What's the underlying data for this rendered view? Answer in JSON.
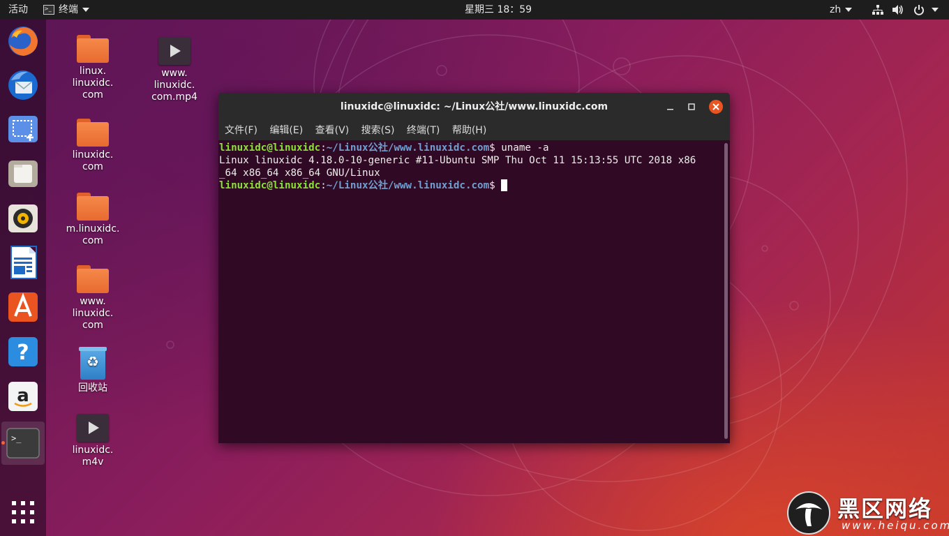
{
  "topbar": {
    "activities": "活动",
    "app_name": "终端",
    "clock": "星期三 18：59",
    "lang": "zh"
  },
  "dock": {
    "items": [
      {
        "name": "firefox"
      },
      {
        "name": "thunderbird"
      },
      {
        "name": "screenshot"
      },
      {
        "name": "files"
      },
      {
        "name": "rhythmbox"
      },
      {
        "name": "libreoffice-writer"
      },
      {
        "name": "ubuntu-software"
      },
      {
        "name": "help"
      },
      {
        "name": "amazon"
      },
      {
        "name": "terminal",
        "active": true
      }
    ]
  },
  "desktop": {
    "icons": [
      {
        "type": "folder",
        "label": "linux.\nlinuxidc.\ncom"
      },
      {
        "type": "video",
        "label": "www.\nlinuxidc.\ncom.mp4"
      },
      {
        "type": "folder",
        "label": "linuxidc.\ncom"
      },
      {
        "type": "folder",
        "label": "m.linuxidc.\ncom"
      },
      {
        "type": "folder",
        "label": "www.\nlinuxidc.\ncom"
      },
      {
        "type": "trash",
        "label": "回收站"
      },
      {
        "type": "video",
        "label": "linuxidc.\nm4v"
      }
    ]
  },
  "terminal": {
    "title": "linuxidc@linuxidc: ~/Linux公社/www.linuxidc.com",
    "menu": [
      "文件(F)",
      "编辑(E)",
      "查看(V)",
      "搜索(S)",
      "终端(T)",
      "帮助(H)"
    ],
    "prompt_user": "linuxidc@linuxidc",
    "prompt_path": "~/Linux公社/www.linuxidc.com",
    "command": " uname -a",
    "output_line1": "Linux linuxidc 4.18.0-10-generic #11-Ubuntu SMP Thu Oct 11 15:13:55 UTC 2018 x86",
    "output_line2": "_64 x86_64 x86_64 GNU/Linux"
  },
  "watermark": {
    "cn": "黑区网络",
    "url": "www.heiqu.com"
  },
  "colors": {
    "accent": "#e95420",
    "terminal_bg": "#300a24",
    "prompt_green": "#8ae234",
    "prompt_blue": "#729fcf"
  }
}
